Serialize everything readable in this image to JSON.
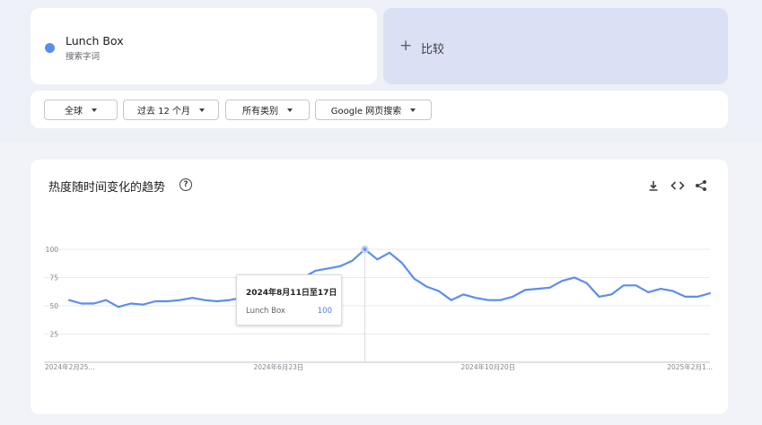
{
  "term": {
    "name": "Lunch Box",
    "subtitle": "搜索字词"
  },
  "compare": {
    "plus": "+",
    "label": "比较"
  },
  "filters": [
    {
      "label": "全球"
    },
    {
      "label": "过去 12 个月"
    },
    {
      "label": "所有类别"
    },
    {
      "label": "Google 网页搜索"
    }
  ],
  "panel": {
    "title": "热度随时间变化的趋势",
    "help_glyph": "?",
    "tools": [
      "download-icon",
      "embed-code-icon",
      "share-icon"
    ]
  },
  "colors": {
    "series": "#5b8def",
    "accent": "#4c7fe0",
    "compare_bg": "#dbe0f4"
  },
  "tooltip": {
    "date": "2024年8月11日至17日",
    "term": "Lunch Box",
    "value": "100"
  },
  "chart_data": {
    "type": "line",
    "ylim": [
      0,
      100
    ],
    "yticks": [
      25,
      50,
      75,
      100
    ],
    "x_tick_labels": [
      "2024年2月25...",
      "2024年6月23日",
      "2024年10月20日",
      "2025年2月1..."
    ],
    "x_tick_indices": [
      0,
      17,
      34,
      52
    ],
    "highlight_index": 24,
    "grid": true,
    "series": [
      {
        "values": [
          55,
          52,
          52,
          55,
          49,
          52,
          51,
          54,
          54,
          55,
          57,
          55,
          54,
          55,
          57,
          60,
          62,
          66,
          70,
          75,
          81,
          83,
          85,
          90,
          100,
          91,
          97,
          88,
          74,
          67,
          63,
          55,
          60,
          57,
          55,
          55,
          58,
          64,
          65,
          66,
          72,
          75,
          70,
          58,
          60,
          68,
          68,
          62,
          65,
          63,
          58,
          58,
          61
        ]
      }
    ]
  }
}
